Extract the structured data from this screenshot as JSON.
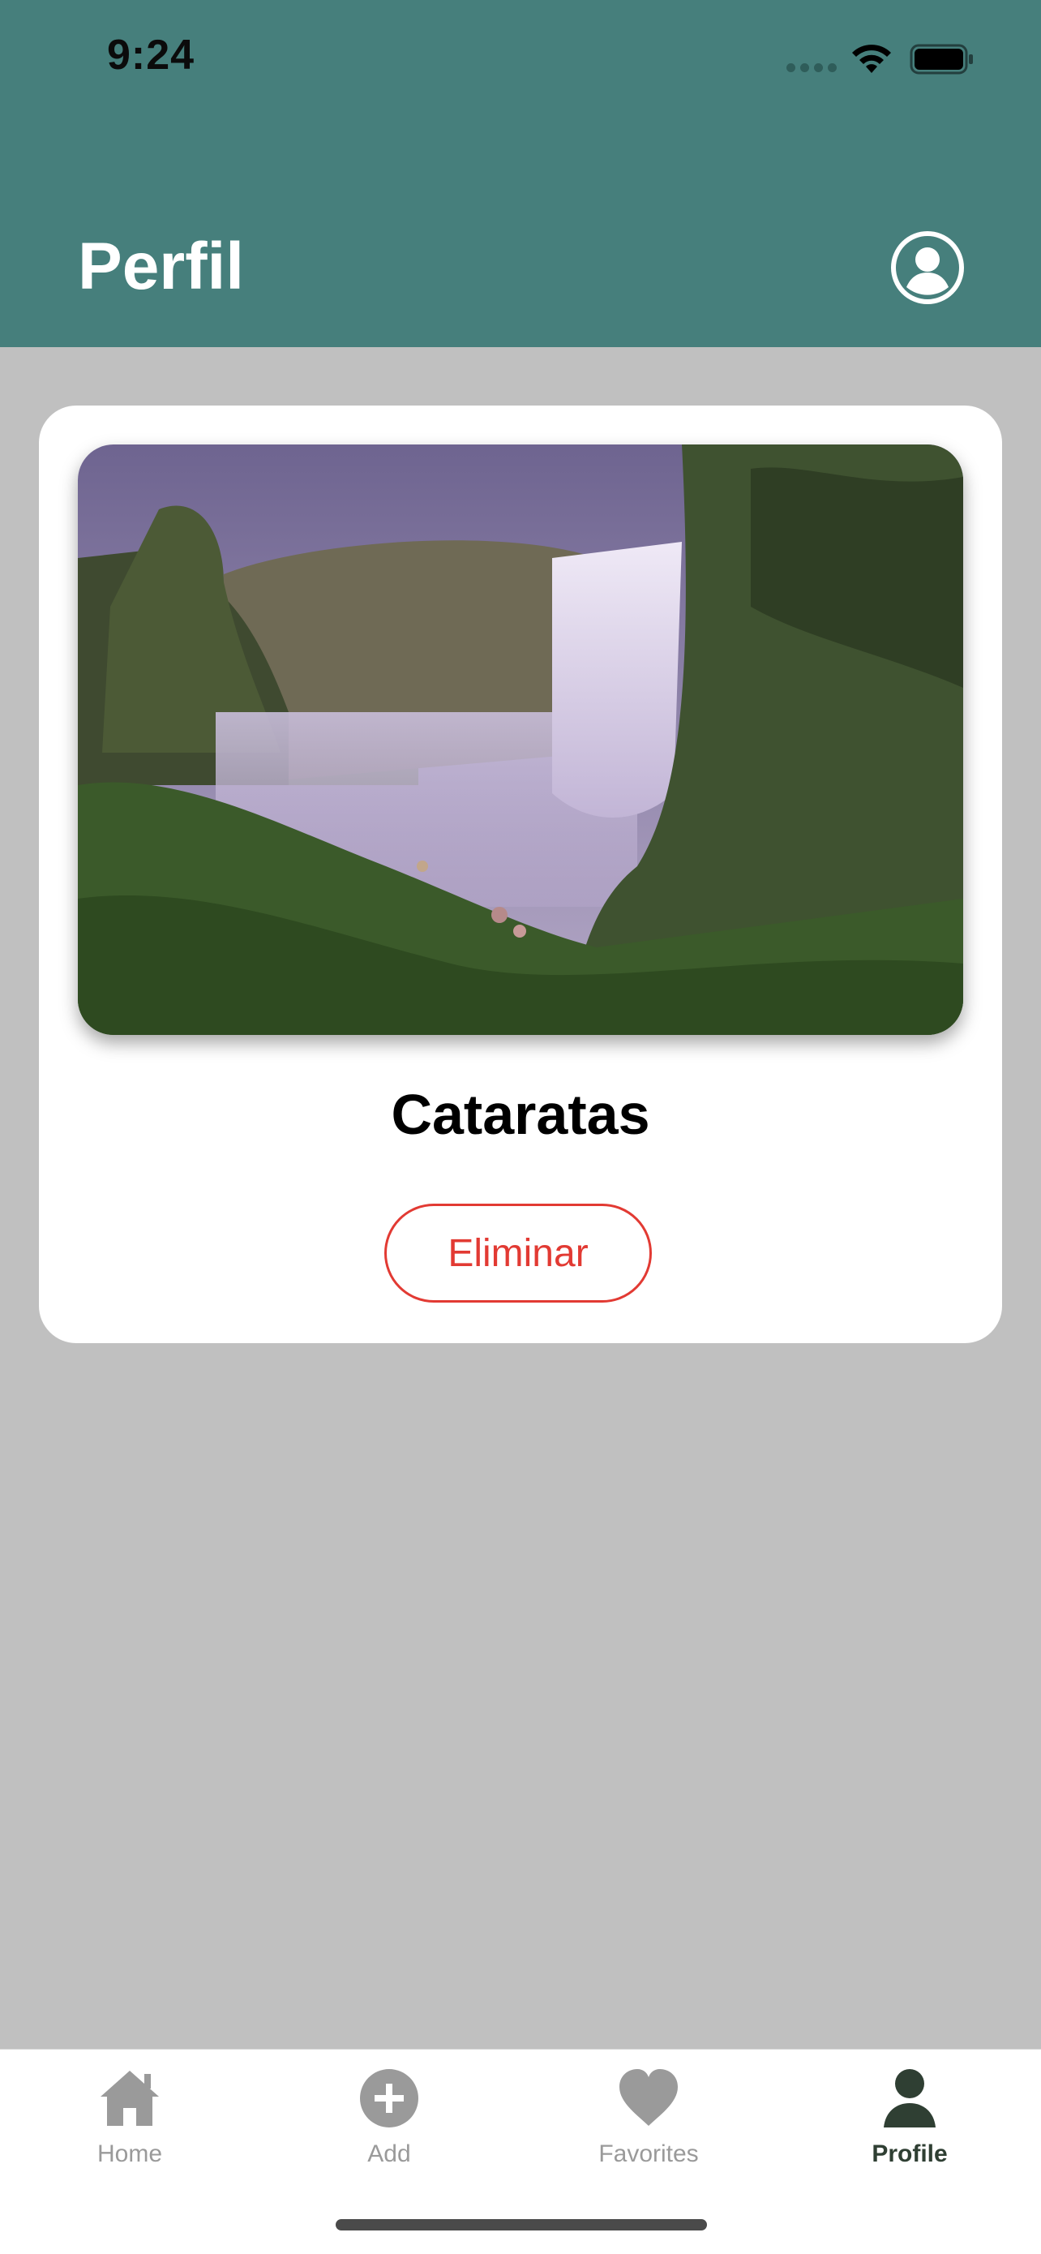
{
  "status_bar": {
    "time": "9:24"
  },
  "header": {
    "title": "Perfil",
    "profile_icon": "person-circle-icon"
  },
  "card": {
    "title": "Cataratas",
    "delete_label": "Eliminar",
    "image": "waterfall-photo"
  },
  "tabbar": {
    "items": [
      {
        "label": "Home",
        "icon": "house-icon",
        "active": false
      },
      {
        "label": "Add",
        "icon": "plus-circle-icon",
        "active": false
      },
      {
        "label": "Favorites",
        "icon": "heart-icon",
        "active": false
      },
      {
        "label": "Profile",
        "icon": "person-icon",
        "active": true
      }
    ]
  },
  "colors": {
    "header": "#467f7c",
    "background": "#c0c0c0",
    "delete": "#e23a33",
    "tab_active": "#2f3f33",
    "tab_inactive": "#9a9a9a"
  }
}
